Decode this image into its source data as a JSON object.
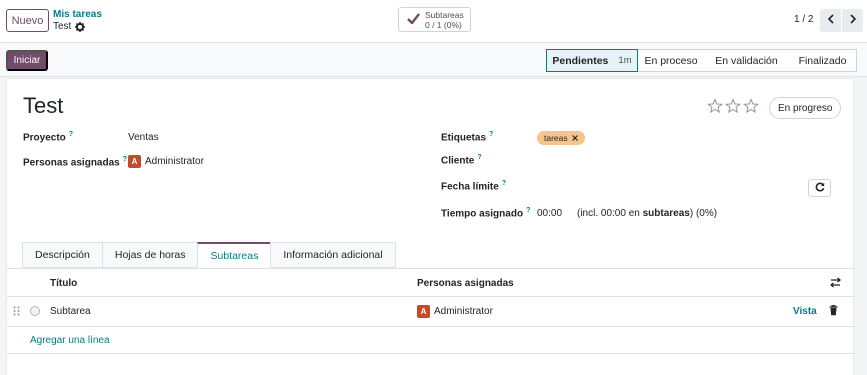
{
  "control_panel": {
    "new_label": "Nuevo",
    "breadcrumb_parent": "Mis tareas",
    "breadcrumb_current": "Test",
    "subtasks_label": "Subtareas",
    "subtasks_count": "0 / 1 (0%)",
    "pager_value": "1 / 2"
  },
  "statusbar": {
    "start_label": "Iniciar",
    "stages": [
      {
        "label": "Pendientes",
        "duration": "1m",
        "active": true
      },
      {
        "label": "En proceso"
      },
      {
        "label": "En validación"
      },
      {
        "label": "Finalizado"
      }
    ]
  },
  "form": {
    "title": "Test",
    "state_label": "En progreso",
    "project_label": "Proyecto",
    "project_value": "Ventas",
    "assignees_label": "Personas asignadas",
    "assignee_initial": "A",
    "assignee_name": "Administrator",
    "tags_label": "Etiquetas",
    "tag_value": "tareas",
    "customer_label": "Cliente",
    "deadline_label": "Fecha límite",
    "allocated_label": "Tiempo asignado",
    "allocated_value": "00:00",
    "allocated_note_prefix": "(incl. 00:00 en ",
    "allocated_note_bold": "subtareas",
    "allocated_note_suffix": ") (0%)",
    "help_mark": "?"
  },
  "tabs": [
    {
      "label": "Descripción"
    },
    {
      "label": "Hojas de horas"
    },
    {
      "label": "Subtareas",
      "active": true
    },
    {
      "label": "Información adicional"
    }
  ],
  "subtasks_table": {
    "col_title": "Título",
    "col_assignees": "Personas asignadas",
    "rows": [
      {
        "title": "Subtarea",
        "assignee_initial": "A",
        "assignee": "Administrator",
        "action": "Vista"
      }
    ],
    "add_line": "Agregar una línea"
  },
  "colors": {
    "brand": "#714B67",
    "accent": "#017e84",
    "tag": "#f7c48c",
    "avatar": "#c44a2c"
  }
}
